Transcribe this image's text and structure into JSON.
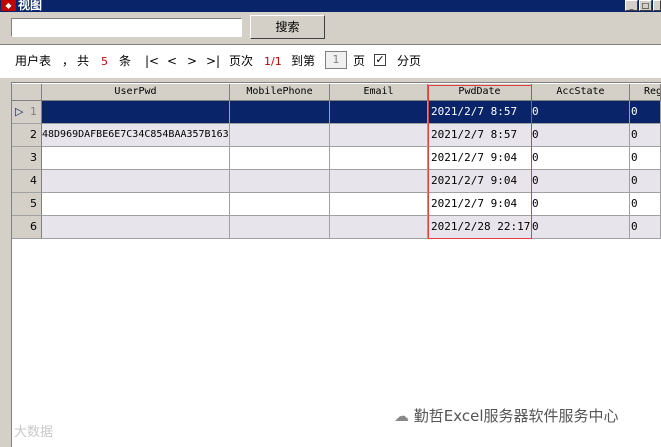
{
  "window": {
    "title": "视图",
    "app_icon": "app-icon"
  },
  "search": {
    "value": "",
    "button_label": "搜索"
  },
  "pager": {
    "table_label": "用户表",
    "sep": "，",
    "total_prefix": "共",
    "total_count": "5",
    "total_suffix": "条",
    "first": "|<",
    "prev": "<",
    "next": ">",
    "last": ">|",
    "page_label": "页次",
    "page_value": "1/1",
    "goto_label": "到第",
    "goto_value": "1",
    "page_suffix": "页",
    "paging_checked": true,
    "paging_label": "分页"
  },
  "grid": {
    "columns": [
      "UserPwd",
      "MobilePhone",
      "Email",
      "PwdDate",
      "AccState",
      "Reg"
    ],
    "rows": [
      {
        "num": "1",
        "UserPwd": "",
        "MobilePhone": "",
        "Email": "",
        "PwdDate": "2021/2/7 8:57",
        "AccState": "0",
        "Reg": "0",
        "selected": true
      },
      {
        "num": "2",
        "UserPwd": "48D969DAFBE6E7C34C854BAA357B163",
        "MobilePhone": "",
        "Email": "",
        "PwdDate": "2021/2/7 8:57",
        "AccState": "0",
        "Reg": "0"
      },
      {
        "num": "3",
        "UserPwd": "",
        "MobilePhone": "",
        "Email": "",
        "PwdDate": "2021/2/7 9:04",
        "AccState": "0",
        "Reg": "0"
      },
      {
        "num": "4",
        "UserPwd": "",
        "MobilePhone": "",
        "Email": "",
        "PwdDate": "2021/2/7 9:04",
        "AccState": "0",
        "Reg": "0"
      },
      {
        "num": "5",
        "UserPwd": "",
        "MobilePhone": "",
        "Email": "",
        "PwdDate": "2021/2/7 9:04",
        "AccState": "0",
        "Reg": "0"
      },
      {
        "num": "6",
        "UserPwd": "",
        "MobilePhone": "",
        "Email": "",
        "PwdDate": "2021/2/28 22:17",
        "AccState": "0",
        "Reg": "0"
      }
    ]
  },
  "watermark": {
    "right": "勤哲Excel服务器软件服务中心",
    "left": "大数据"
  },
  "colors": {
    "title_bar": "#0a246a",
    "selected_row": "#0a246a",
    "highlight_box": "#e04040",
    "count_red": "#c00000"
  }
}
